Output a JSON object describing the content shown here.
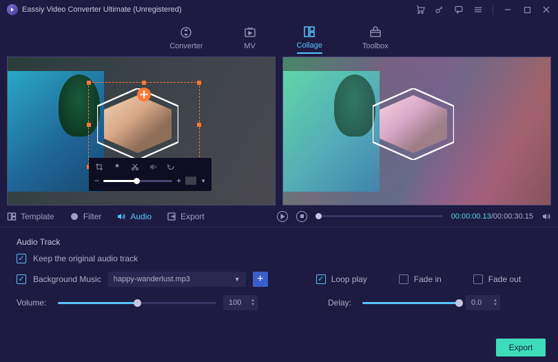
{
  "titlebar": {
    "title": "Eassiy Video Converter Ultimate (Unregistered)"
  },
  "tabs": {
    "converter": "Converter",
    "mv": "MV",
    "collage": "Collage",
    "toolbox": "Toolbox"
  },
  "mid_tabs": {
    "template": "Template",
    "filter": "Filter",
    "audio": "Audio",
    "export": "Export"
  },
  "playback": {
    "current": "00:00:00.13",
    "total": "00:00:30.15"
  },
  "audio": {
    "section_title": "Audio Track",
    "keep_original": "Keep the original audio track",
    "bg_music_label": "Background Music",
    "bg_music_value": "happy-wanderlust.mp3",
    "loop_play": "Loop play",
    "fade_in": "Fade in",
    "fade_out": "Fade out",
    "volume_label": "Volume:",
    "volume_value": "100",
    "delay_label": "Delay:",
    "delay_value": "0.0"
  },
  "footer": {
    "export": "Export"
  },
  "edit_toolbar": {
    "minus": "−",
    "plus": "+"
  }
}
